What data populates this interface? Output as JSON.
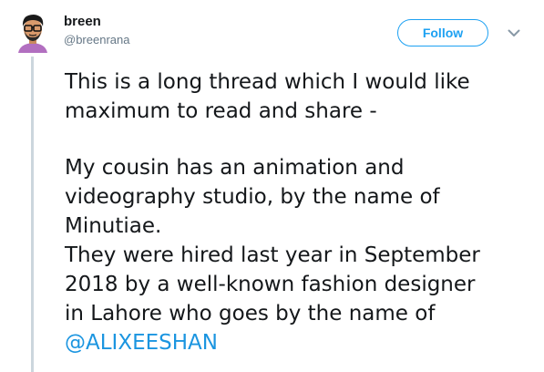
{
  "user": {
    "display_name": "breen",
    "handle": "@breenrana"
  },
  "actions": {
    "follow_label": "Follow",
    "caret_icon": "chevron-down-icon"
  },
  "tweet": {
    "lines_1": [
      "This is a long thread which I would like",
      "maximum to read and share -"
    ],
    "lines_2": [
      "My cousin has an animation and",
      "videography studio, by the name of",
      "Minutiae.",
      "They were hired last year in September",
      "2018 by a well-known fashion designer",
      "in Lahore who goes by the name of"
    ],
    "mention": "@ALIXEESHAN"
  },
  "colors": {
    "accent": "#1da1f2",
    "mention": "#1b95e0",
    "thread_line": "#ccd6dd"
  }
}
